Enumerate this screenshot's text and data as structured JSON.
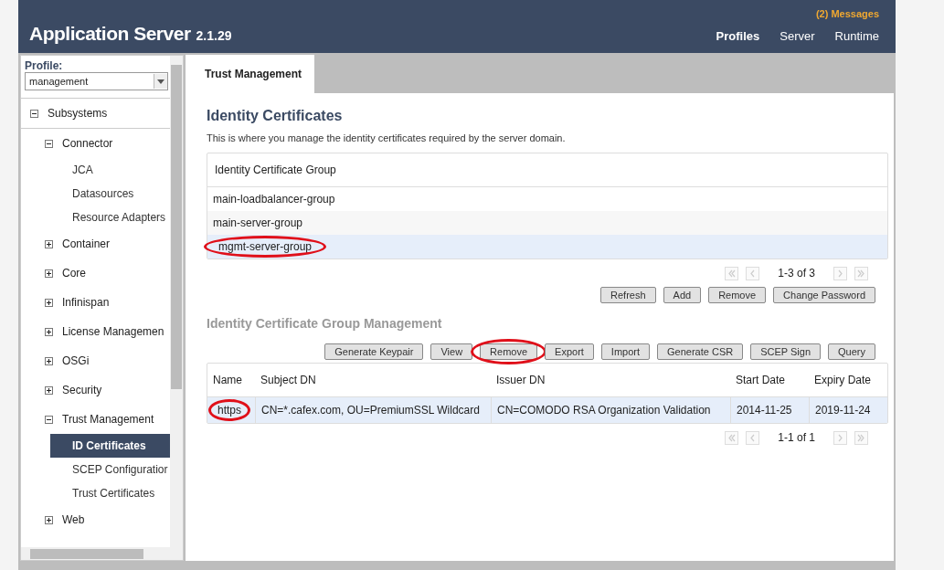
{
  "header": {
    "messages": "(2) Messages",
    "title": "Application Server",
    "version": "2.1.29",
    "nav": [
      {
        "label": "Profiles",
        "selected": true
      },
      {
        "label": "Server",
        "selected": false
      },
      {
        "label": "Runtime",
        "selected": false
      }
    ]
  },
  "sidebar": {
    "profile_label": "Profile:",
    "profile_value": "management",
    "tree": [
      {
        "label": "Subsystems",
        "expanded": true,
        "children": [
          {
            "label": "Connector",
            "expanded": true,
            "children": [
              {
                "label": "JCA",
                "selected": false
              },
              {
                "label": "Datasources",
                "selected": false
              },
              {
                "label": "Resource Adapters",
                "selected": false
              }
            ]
          },
          {
            "label": "Container",
            "expanded": false
          },
          {
            "label": "Core",
            "expanded": false
          },
          {
            "label": "Infinispan",
            "expanded": false
          },
          {
            "label": "License Managemen",
            "expanded": false
          },
          {
            "label": "OSGi",
            "expanded": false
          },
          {
            "label": "Security",
            "expanded": false
          },
          {
            "label": "Trust Management",
            "expanded": true,
            "children": [
              {
                "label": "ID Certificates",
                "selected": true
              },
              {
                "label": "SCEP Configuratior",
                "selected": false
              },
              {
                "label": "Trust Certificates",
                "selected": false
              }
            ]
          },
          {
            "label": "Web",
            "expanded": false
          }
        ]
      }
    ]
  },
  "content": {
    "tabs": [
      {
        "label": "Trust Management",
        "selected": true
      }
    ],
    "heading": "Identity Certificates",
    "description": "This is where you manage the identity certificates required by the server domain.",
    "groups": {
      "column": "Identity Certificate Group",
      "rows": [
        {
          "name": "main-loadbalancer-group",
          "selected": false,
          "circled": false
        },
        {
          "name": "main-server-group",
          "selected": false,
          "circled": false
        },
        {
          "name": "mgmt-server-group",
          "selected": true,
          "circled": true
        }
      ],
      "pager": "1-3 of 3",
      "buttons": [
        {
          "label": "Refresh",
          "circled": false
        },
        {
          "label": "Add",
          "circled": false
        },
        {
          "label": "Remove",
          "circled": false
        },
        {
          "label": "Change Password",
          "circled": false
        }
      ]
    },
    "management": {
      "heading": "Identity Certificate Group Management",
      "buttons": [
        {
          "label": "Generate Keypair",
          "circled": false
        },
        {
          "label": "View",
          "circled": false
        },
        {
          "label": "Remove",
          "circled": true
        },
        {
          "label": "Export",
          "circled": false
        },
        {
          "label": "Import",
          "circled": false
        },
        {
          "label": "Generate CSR",
          "circled": false
        },
        {
          "label": "SCEP Sign",
          "circled": false
        },
        {
          "label": "Query",
          "circled": false
        }
      ],
      "columns": [
        "Name",
        "Subject DN",
        "Issuer DN",
        "Start Date",
        "Expiry Date"
      ],
      "rows": [
        {
          "cells": [
            {
              "text": "https",
              "circled": true
            },
            {
              "text": "CN=*.cafex.com, OU=PremiumSSL Wildcard",
              "circled": false
            },
            {
              "text": "CN=COMODO RSA Organization Validation",
              "circled": false
            },
            {
              "text": "2014-11-25",
              "circled": false
            },
            {
              "text": "2019-11-24",
              "circled": false
            }
          ],
          "selected": true
        }
      ],
      "pager": "1-1 of 1"
    }
  }
}
